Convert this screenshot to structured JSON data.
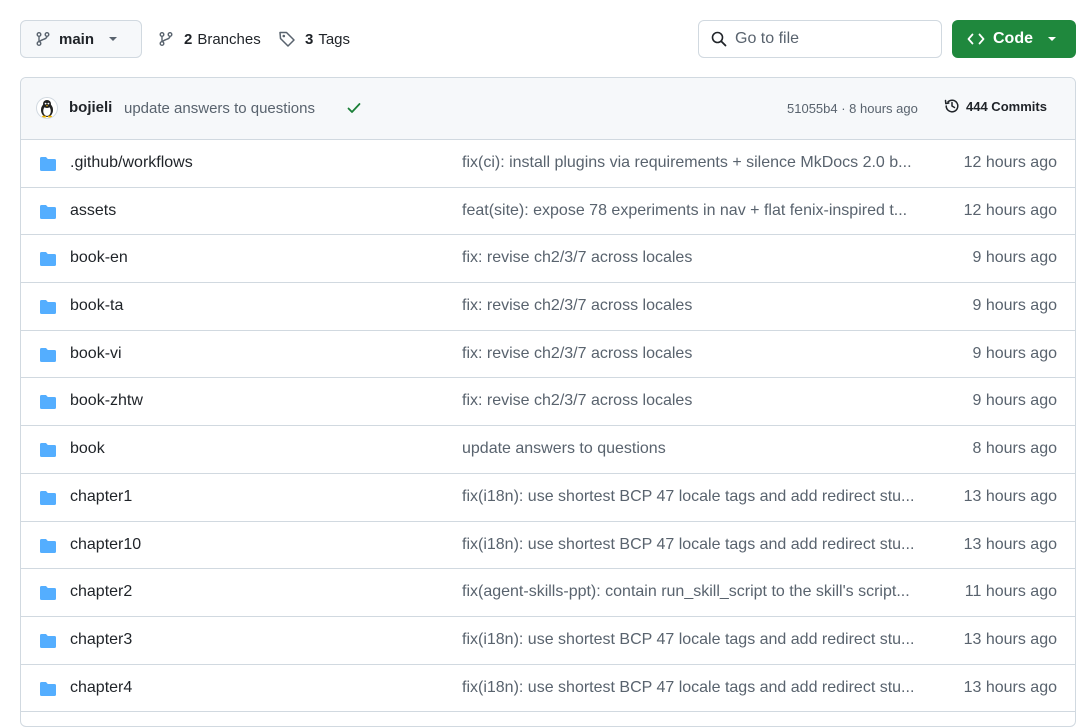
{
  "toolbar": {
    "branch": "main",
    "branches_count": "2",
    "branches_label": "Branches",
    "tags_count": "3",
    "tags_label": "Tags",
    "search_placeholder": "Go to file",
    "code_label": "Code"
  },
  "colors": {
    "code_button": "#1f883d",
    "folder": "#54aeff",
    "check": "#1a7f37"
  },
  "commit": {
    "author": "bojieli",
    "message": "update answers to questions",
    "hash_time": "51055b4 · 8 hours ago",
    "commits_label": "444 Commits"
  },
  "files": [
    {
      "name": ".github/workflows",
      "message": "fix(ci): install plugins via requirements + silence MkDocs 2.0 b...",
      "age": "12 hours ago"
    },
    {
      "name": "assets",
      "message": "feat(site): expose 78 experiments in nav + flat fenix-inspired t...",
      "age": "12 hours ago"
    },
    {
      "name": "book-en",
      "message": "fix: revise ch2/3/7 across locales",
      "age": "9 hours ago"
    },
    {
      "name": "book-ta",
      "message": "fix: revise ch2/3/7 across locales",
      "age": "9 hours ago"
    },
    {
      "name": "book-vi",
      "message": "fix: revise ch2/3/7 across locales",
      "age": "9 hours ago"
    },
    {
      "name": "book-zhtw",
      "message": "fix: revise ch2/3/7 across locales",
      "age": "9 hours ago"
    },
    {
      "name": "book",
      "message": "update answers to questions",
      "age": "8 hours ago"
    },
    {
      "name": "chapter1",
      "message": "fix(i18n): use shortest BCP 47 locale tags and add redirect stu...",
      "age": "13 hours ago"
    },
    {
      "name": "chapter10",
      "message": "fix(i18n): use shortest BCP 47 locale tags and add redirect stu...",
      "age": "13 hours ago"
    },
    {
      "name": "chapter2",
      "message": "fix(agent-skills-ppt): contain run_skill_script to the skill's script...",
      "age": "11 hours ago"
    },
    {
      "name": "chapter3",
      "message": "fix(i18n): use shortest BCP 47 locale tags and add redirect stu...",
      "age": "13 hours ago"
    },
    {
      "name": "chapter4",
      "message": "fix(i18n): use shortest BCP 47 locale tags and add redirect stu...",
      "age": "13 hours ago"
    }
  ]
}
